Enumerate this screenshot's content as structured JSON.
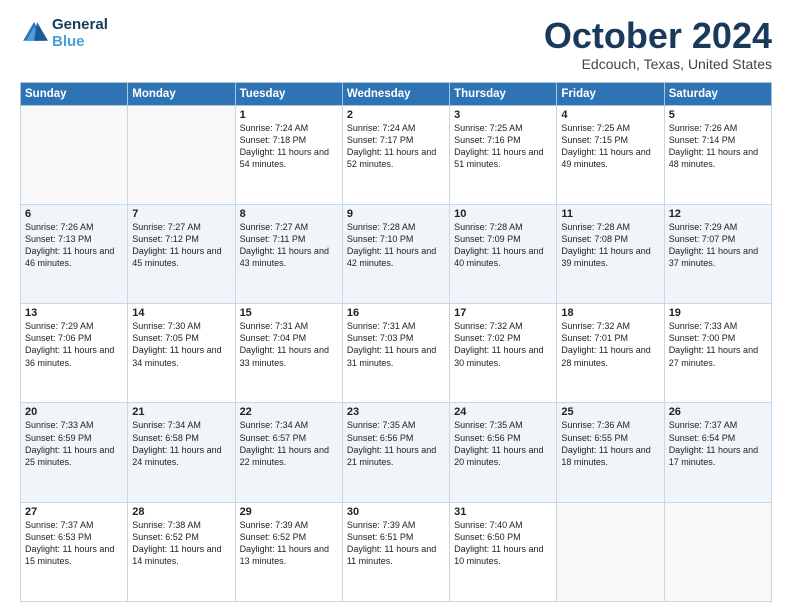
{
  "logo": {
    "line1": "General",
    "line2": "Blue"
  },
  "title": "October 2024",
  "subtitle": "Edcouch, Texas, United States",
  "days_header": [
    "Sunday",
    "Monday",
    "Tuesday",
    "Wednesday",
    "Thursday",
    "Friday",
    "Saturday"
  ],
  "weeks": [
    [
      {
        "num": "",
        "sunrise": "",
        "sunset": "",
        "daylight": ""
      },
      {
        "num": "",
        "sunrise": "",
        "sunset": "",
        "daylight": ""
      },
      {
        "num": "1",
        "sunrise": "Sunrise: 7:24 AM",
        "sunset": "Sunset: 7:18 PM",
        "daylight": "Daylight: 11 hours and 54 minutes."
      },
      {
        "num": "2",
        "sunrise": "Sunrise: 7:24 AM",
        "sunset": "Sunset: 7:17 PM",
        "daylight": "Daylight: 11 hours and 52 minutes."
      },
      {
        "num": "3",
        "sunrise": "Sunrise: 7:25 AM",
        "sunset": "Sunset: 7:16 PM",
        "daylight": "Daylight: 11 hours and 51 minutes."
      },
      {
        "num": "4",
        "sunrise": "Sunrise: 7:25 AM",
        "sunset": "Sunset: 7:15 PM",
        "daylight": "Daylight: 11 hours and 49 minutes."
      },
      {
        "num": "5",
        "sunrise": "Sunrise: 7:26 AM",
        "sunset": "Sunset: 7:14 PM",
        "daylight": "Daylight: 11 hours and 48 minutes."
      }
    ],
    [
      {
        "num": "6",
        "sunrise": "Sunrise: 7:26 AM",
        "sunset": "Sunset: 7:13 PM",
        "daylight": "Daylight: 11 hours and 46 minutes."
      },
      {
        "num": "7",
        "sunrise": "Sunrise: 7:27 AM",
        "sunset": "Sunset: 7:12 PM",
        "daylight": "Daylight: 11 hours and 45 minutes."
      },
      {
        "num": "8",
        "sunrise": "Sunrise: 7:27 AM",
        "sunset": "Sunset: 7:11 PM",
        "daylight": "Daylight: 11 hours and 43 minutes."
      },
      {
        "num": "9",
        "sunrise": "Sunrise: 7:28 AM",
        "sunset": "Sunset: 7:10 PM",
        "daylight": "Daylight: 11 hours and 42 minutes."
      },
      {
        "num": "10",
        "sunrise": "Sunrise: 7:28 AM",
        "sunset": "Sunset: 7:09 PM",
        "daylight": "Daylight: 11 hours and 40 minutes."
      },
      {
        "num": "11",
        "sunrise": "Sunrise: 7:28 AM",
        "sunset": "Sunset: 7:08 PM",
        "daylight": "Daylight: 11 hours and 39 minutes."
      },
      {
        "num": "12",
        "sunrise": "Sunrise: 7:29 AM",
        "sunset": "Sunset: 7:07 PM",
        "daylight": "Daylight: 11 hours and 37 minutes."
      }
    ],
    [
      {
        "num": "13",
        "sunrise": "Sunrise: 7:29 AM",
        "sunset": "Sunset: 7:06 PM",
        "daylight": "Daylight: 11 hours and 36 minutes."
      },
      {
        "num": "14",
        "sunrise": "Sunrise: 7:30 AM",
        "sunset": "Sunset: 7:05 PM",
        "daylight": "Daylight: 11 hours and 34 minutes."
      },
      {
        "num": "15",
        "sunrise": "Sunrise: 7:31 AM",
        "sunset": "Sunset: 7:04 PM",
        "daylight": "Daylight: 11 hours and 33 minutes."
      },
      {
        "num": "16",
        "sunrise": "Sunrise: 7:31 AM",
        "sunset": "Sunset: 7:03 PM",
        "daylight": "Daylight: 11 hours and 31 minutes."
      },
      {
        "num": "17",
        "sunrise": "Sunrise: 7:32 AM",
        "sunset": "Sunset: 7:02 PM",
        "daylight": "Daylight: 11 hours and 30 minutes."
      },
      {
        "num": "18",
        "sunrise": "Sunrise: 7:32 AM",
        "sunset": "Sunset: 7:01 PM",
        "daylight": "Daylight: 11 hours and 28 minutes."
      },
      {
        "num": "19",
        "sunrise": "Sunrise: 7:33 AM",
        "sunset": "Sunset: 7:00 PM",
        "daylight": "Daylight: 11 hours and 27 minutes."
      }
    ],
    [
      {
        "num": "20",
        "sunrise": "Sunrise: 7:33 AM",
        "sunset": "Sunset: 6:59 PM",
        "daylight": "Daylight: 11 hours and 25 minutes."
      },
      {
        "num": "21",
        "sunrise": "Sunrise: 7:34 AM",
        "sunset": "Sunset: 6:58 PM",
        "daylight": "Daylight: 11 hours and 24 minutes."
      },
      {
        "num": "22",
        "sunrise": "Sunrise: 7:34 AM",
        "sunset": "Sunset: 6:57 PM",
        "daylight": "Daylight: 11 hours and 22 minutes."
      },
      {
        "num": "23",
        "sunrise": "Sunrise: 7:35 AM",
        "sunset": "Sunset: 6:56 PM",
        "daylight": "Daylight: 11 hours and 21 minutes."
      },
      {
        "num": "24",
        "sunrise": "Sunrise: 7:35 AM",
        "sunset": "Sunset: 6:56 PM",
        "daylight": "Daylight: 11 hours and 20 minutes."
      },
      {
        "num": "25",
        "sunrise": "Sunrise: 7:36 AM",
        "sunset": "Sunset: 6:55 PM",
        "daylight": "Daylight: 11 hours and 18 minutes."
      },
      {
        "num": "26",
        "sunrise": "Sunrise: 7:37 AM",
        "sunset": "Sunset: 6:54 PM",
        "daylight": "Daylight: 11 hours and 17 minutes."
      }
    ],
    [
      {
        "num": "27",
        "sunrise": "Sunrise: 7:37 AM",
        "sunset": "Sunset: 6:53 PM",
        "daylight": "Daylight: 11 hours and 15 minutes."
      },
      {
        "num": "28",
        "sunrise": "Sunrise: 7:38 AM",
        "sunset": "Sunset: 6:52 PM",
        "daylight": "Daylight: 11 hours and 14 minutes."
      },
      {
        "num": "29",
        "sunrise": "Sunrise: 7:39 AM",
        "sunset": "Sunset: 6:52 PM",
        "daylight": "Daylight: 11 hours and 13 minutes."
      },
      {
        "num": "30",
        "sunrise": "Sunrise: 7:39 AM",
        "sunset": "Sunset: 6:51 PM",
        "daylight": "Daylight: 11 hours and 11 minutes."
      },
      {
        "num": "31",
        "sunrise": "Sunrise: 7:40 AM",
        "sunset": "Sunset: 6:50 PM",
        "daylight": "Daylight: 11 hours and 10 minutes."
      },
      {
        "num": "",
        "sunrise": "",
        "sunset": "",
        "daylight": ""
      },
      {
        "num": "",
        "sunrise": "",
        "sunset": "",
        "daylight": ""
      }
    ]
  ]
}
